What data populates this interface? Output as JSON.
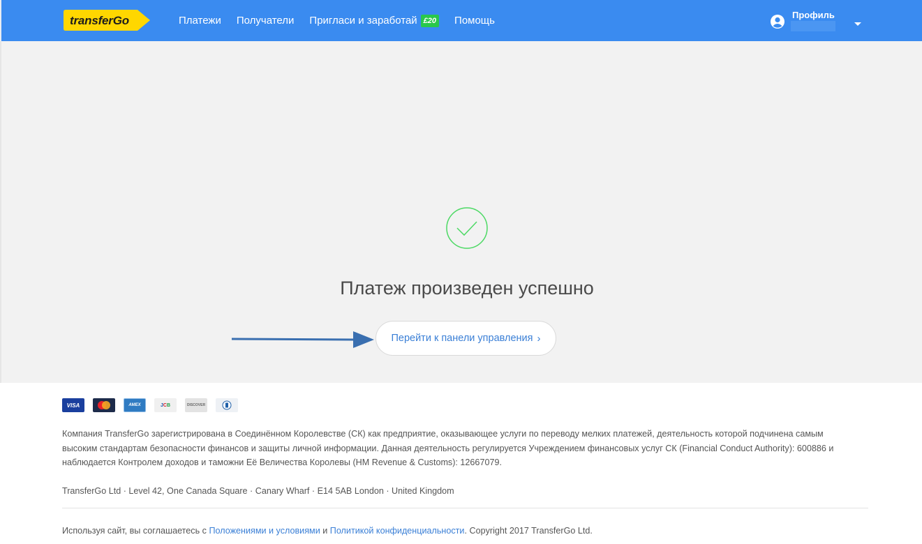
{
  "header": {
    "logo_text": "transferGo",
    "nav": [
      {
        "label": "Платежи"
      },
      {
        "label": "Получатели"
      },
      {
        "label": "Пригласи и заработай",
        "badge": "£20"
      },
      {
        "label": "Помощь"
      }
    ],
    "profile_label": "Профиль",
    "colors": {
      "background": "#3a8bf0",
      "logo": "#ffd700",
      "badge": "#29c84b"
    }
  },
  "main": {
    "success_icon": "check-circle-icon",
    "title": "Платеж произведен успешно",
    "dashboard_button": "Перейти к панели управления",
    "dashboard_chevron": "›",
    "colors": {
      "check": "#4cd964",
      "link": "#3a7fd6",
      "arrow": "#3a6fb0"
    }
  },
  "footer": {
    "cards": [
      {
        "name": "visa",
        "text": "VISA"
      },
      {
        "name": "mastercard",
        "text": ""
      },
      {
        "name": "amex",
        "text": "AMEX"
      },
      {
        "name": "jcb",
        "text": "JCB"
      },
      {
        "name": "discover",
        "text": "DISCOVER"
      },
      {
        "name": "diners",
        "text": ""
      }
    ],
    "legal_text": "Компания TransferGo зарегистрирована в Соединённом Королевстве (СК) как предприятие, оказывающее услуги по переводу мелких платежей, деятельность которой подчинена самым высоким стандартам безопасности финансов и защиты личной информации. Данная деятельность регулируется Учреждением финансовых услуг СК (Financial Conduct Authority): 600886 и наблюдается Контролем доходов и таможни Её Величества Королевы (HM Revenue & Customs): 12667079.",
    "address": "TransferGo Ltd · Level 42, One Canada Square · Canary Wharf · E14 5AB London · United Kingdom",
    "consent_prefix": "Используя сайт, вы соглашаетесь с ",
    "terms_link": "Положениями и условиями",
    "consent_and": " и ",
    "privacy_link": "Политикой конфиденциальности",
    "copyright": ". Copyright 2017 TransferGo Ltd."
  }
}
